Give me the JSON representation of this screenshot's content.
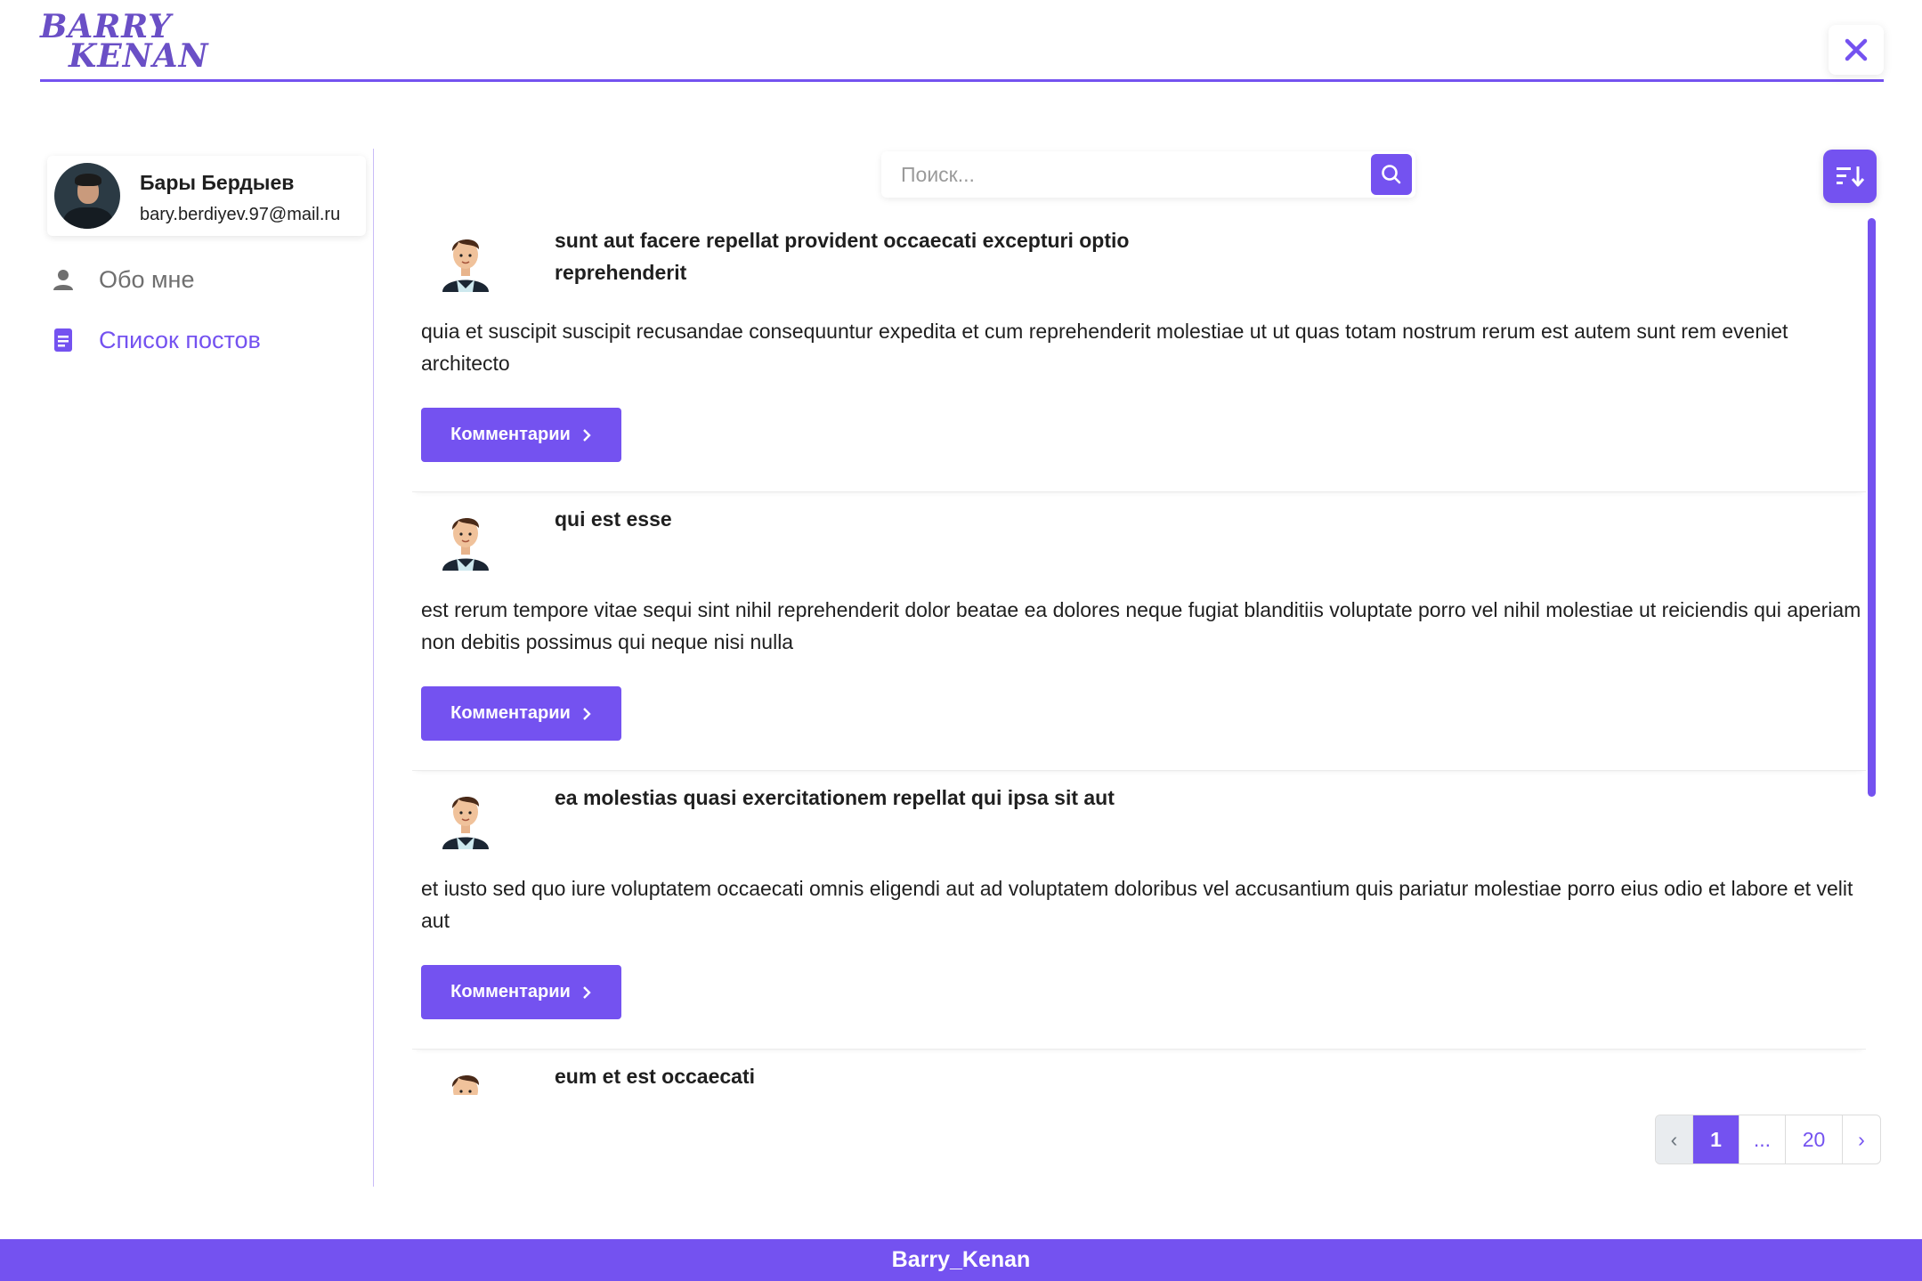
{
  "header": {
    "logo_line1": "BARRY",
    "logo_line2": "KENAN"
  },
  "profile": {
    "name": "Бары Бердыев",
    "email": "bary.berdiyev.97@mail.ru"
  },
  "nav": {
    "about_label": "Обо мне",
    "posts_label": "Список постов"
  },
  "search": {
    "placeholder": "Поиск...",
    "value": ""
  },
  "posts": [
    {
      "title": "sunt aut facere repellat provident occaecati excepturi optio reprehenderit",
      "body": "quia et suscipit suscipit recusandae consequuntur expedita et cum reprehenderit molestiae ut ut quas totam nostrum rerum est autem sunt rem eveniet architecto",
      "button_label": "Комментарии"
    },
    {
      "title": "qui est esse",
      "body": "est rerum tempore vitae sequi sint nihil reprehenderit dolor beatae ea dolores neque fugiat blanditiis voluptate porro vel nihil molestiae ut reiciendis qui aperiam non debitis possimus qui neque nisi nulla",
      "button_label": "Комментарии"
    },
    {
      "title": "ea molestias quasi exercitationem repellat qui ipsa sit aut",
      "body": "et iusto sed quo iure voluptatem occaecati omnis eligendi aut ad voluptatem doloribus vel accusantium quis pariatur molestiae porro eius odio et labore et velit aut",
      "button_label": "Комментарии"
    },
    {
      "title": "eum et est occaecati",
      "body": "",
      "button_label": ""
    }
  ],
  "pagination": {
    "prev": "‹",
    "current": "1",
    "ellipsis": "...",
    "last": "20",
    "next": "›"
  },
  "footer": {
    "text": "Barry_Kenan"
  },
  "colors": {
    "accent": "#7452f0",
    "logo": "#6a4fc6",
    "sidebar_divider": "#c9bcf7"
  },
  "icons": {
    "close": "close-icon",
    "search": "search-icon",
    "sort": "sort-icon",
    "about": "user-icon",
    "posts": "document-icon",
    "chevron": "chevron-right-icon"
  }
}
